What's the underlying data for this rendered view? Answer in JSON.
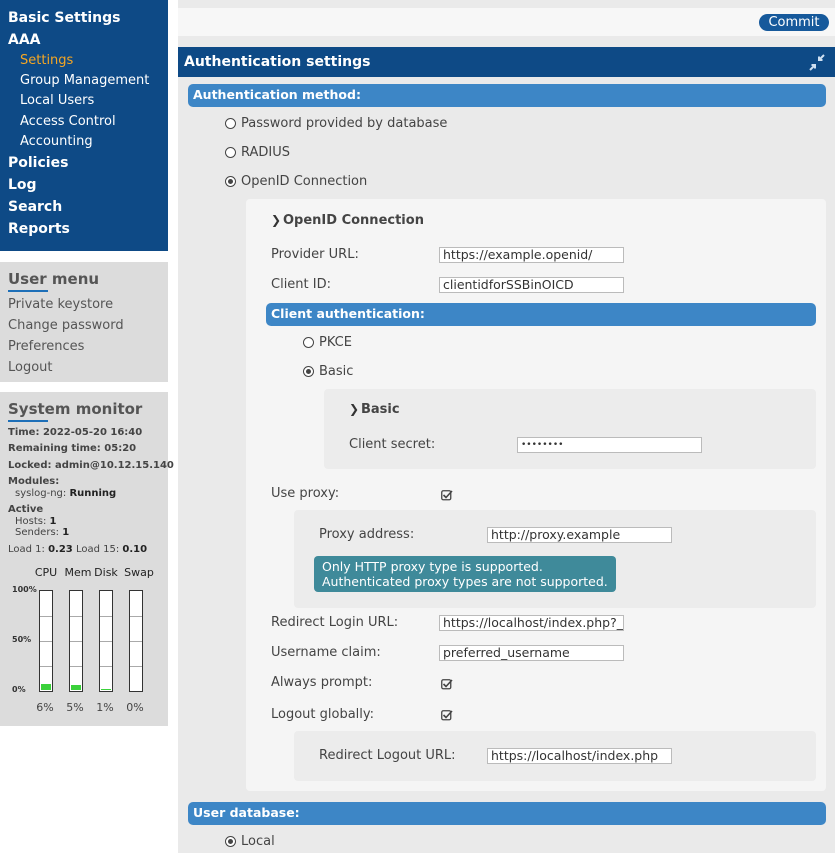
{
  "nav": {
    "items": [
      {
        "label": "Basic Settings"
      },
      {
        "label": "AAA"
      },
      {
        "label": "Policies"
      },
      {
        "label": "Log"
      },
      {
        "label": "Search"
      },
      {
        "label": "Reports"
      }
    ],
    "aaa_sub": [
      {
        "label": "Settings",
        "active": true
      },
      {
        "label": "Group Management"
      },
      {
        "label": "Local Users"
      },
      {
        "label": "Access Control"
      },
      {
        "label": "Accounting"
      }
    ]
  },
  "user_menu": {
    "title": "User menu",
    "links": [
      "Private keystore",
      "Change password",
      "Preferences",
      "Logout"
    ]
  },
  "system_monitor": {
    "title": "System monitor",
    "time_label": "Time:",
    "time": "2022-05-20 16:40",
    "remaining_label": "Remaining time:",
    "remaining": "05:20",
    "locked_label": "Locked:",
    "locked": "admin@10.12.15.140",
    "modules_label": "Modules:",
    "syslog_label": "syslog-ng:",
    "syslog": "Running",
    "active_label": "Active",
    "hosts_label": "Hosts:",
    "hosts": "1",
    "senders_label": "Senders:",
    "senders": "1",
    "load1_label": "Load 1:",
    "load1": "0.23",
    "load15_label": "Load 15:",
    "load15": "0.10",
    "scale": [
      "100%",
      "50%",
      "0%"
    ],
    "gauges": [
      {
        "name": "CPU",
        "pct_text": "6%",
        "value": 6
      },
      {
        "name": "Mem",
        "pct_text": "5%",
        "value": 5
      },
      {
        "name": "Disk",
        "pct_text": "1%",
        "value": 1
      },
      {
        "name": "Swap",
        "pct_text": "0%",
        "value": 0
      }
    ],
    "gauge_color": "#3bd13b"
  },
  "toolbar": {
    "commit_label": "Commit"
  },
  "panel": {
    "title": "Authentication settings",
    "collapse_icon": "compress-arrows-icon",
    "auth_method": {
      "heading": "Authentication method:",
      "options": [
        {
          "label": "Password provided by database",
          "selected": false
        },
        {
          "label": "RADIUS",
          "selected": false
        },
        {
          "label": "OpenID Connection",
          "selected": true
        }
      ]
    },
    "oidc": {
      "title": "OpenID Connection",
      "provider_url_label": "Provider URL:",
      "provider_url": "https://example.openid/",
      "client_id_label": "Client ID:",
      "client_id": "clientidforSSBinOICD",
      "client_auth_heading": "Client authentication:",
      "client_auth_options": [
        {
          "label": "PKCE",
          "selected": false
        },
        {
          "label": "Basic",
          "selected": true
        }
      ],
      "basic": {
        "title": "Basic",
        "client_secret_label": "Client secret:",
        "client_secret": "••••••••"
      },
      "use_proxy_label": "Use proxy:",
      "use_proxy": true,
      "proxy_address_label": "Proxy address:",
      "proxy_address": "http://proxy.example",
      "proxy_tooltip": [
        "Only HTTP proxy type is supported.",
        "Authenticated proxy types are not supported."
      ],
      "redirect_login_label": "Redirect Login URL:",
      "redirect_login": "https://localhost/index.php?_",
      "username_claim_label": "Username claim:",
      "username_claim": "preferred_username",
      "always_prompt_label": "Always prompt:",
      "always_prompt": true,
      "logout_globally_label": "Logout globally:",
      "logout_globally": true,
      "redirect_logout_label": "Redirect Logout URL:",
      "redirect_logout": "https://localhost/index.php"
    },
    "user_db": {
      "heading": "User database:",
      "options": [
        {
          "label": "Local",
          "selected": true
        }
      ]
    }
  },
  "colors": {
    "nav_bg": "#0e4a86",
    "section_bar": "#3d86c6",
    "active_nav": "#f5a623",
    "tooltip_bg": "#3f8a9a"
  }
}
